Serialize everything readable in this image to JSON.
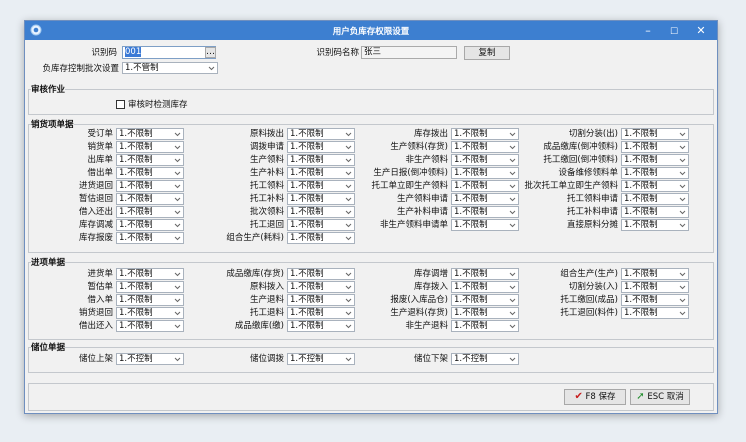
{
  "window": {
    "title": "用户负库存权限设置"
  },
  "header": {
    "code_label": "识别码",
    "code_value": "001",
    "code_name_label": "识别码名称",
    "code_name_value": "张三",
    "copy_label": "复制",
    "batch_label": "负库存控制批次设置",
    "batch_value": "1.不管制"
  },
  "audit": {
    "title": "审核作业",
    "checkbox_label": "审核时检测库存"
  },
  "sales": {
    "title": "销货项单据",
    "fields": [
      {
        "label": "受订单",
        "value": "1.不限制"
      },
      {
        "label": "销货单",
        "value": "1.不限制"
      },
      {
        "label": "出库单",
        "value": "1.不限制"
      },
      {
        "label": "借出单",
        "value": "1.不限制"
      },
      {
        "label": "进货退回",
        "value": "1.不限制"
      },
      {
        "label": "暂估退回",
        "value": "1.不限制"
      },
      {
        "label": "借入还出",
        "value": "1.不限制"
      },
      {
        "label": "库存调减",
        "value": "1.不限制"
      },
      {
        "label": "库存报废",
        "value": "1.不限制"
      },
      {
        "label": "原料拨出",
        "value": "1.不限制"
      },
      {
        "label": "调拨申请",
        "value": "1.不限制"
      },
      {
        "label": "生产领料",
        "value": "1.不限制"
      },
      {
        "label": "生产补料",
        "value": "1.不限制"
      },
      {
        "label": "托工领料",
        "value": "1.不限制"
      },
      {
        "label": "托工补料",
        "value": "1.不限制"
      },
      {
        "label": "批次领料",
        "value": "1.不限制"
      },
      {
        "label": "托工退回",
        "value": "1.不限制"
      },
      {
        "label": "组合生产(耗料)",
        "value": "1.不限制"
      },
      {
        "label": "库存拨出",
        "value": "1.不限制"
      },
      {
        "label": "生产领料(存货)",
        "value": "1.不限制"
      },
      {
        "label": "非生产领料",
        "value": "1.不限制"
      },
      {
        "label": "生产日报(倒冲领料)",
        "value": "1.不限制"
      },
      {
        "label": "托工单立即生产领料",
        "value": "1.不限制"
      },
      {
        "label": "生产领料申请",
        "value": "1.不限制"
      },
      {
        "label": "生产补料申请",
        "value": "1.不限制"
      },
      {
        "label": "非生产领料申请单",
        "value": "1.不限制"
      },
      {
        "label": "切割分装(出)",
        "value": "1.不限制"
      },
      {
        "label": "成品缴库(倒冲领料)",
        "value": "1.不限制"
      },
      {
        "label": "托工缴回(倒冲领料)",
        "value": "1.不限制"
      },
      {
        "label": "设备维修领料单",
        "value": "1.不限制"
      },
      {
        "label": "批次托工单立即生产领料",
        "value": "1.不限制"
      },
      {
        "label": "托工领料申请",
        "value": "1.不限制"
      },
      {
        "label": "托工补料申请",
        "value": "1.不限制"
      },
      {
        "label": "直接原料分摊",
        "value": "1.不限制"
      }
    ]
  },
  "incoming": {
    "title": "进项单据",
    "fields": [
      {
        "label": "进货单",
        "value": "1.不限制"
      },
      {
        "label": "暂估单",
        "value": "1.不限制"
      },
      {
        "label": "借入单",
        "value": "1.不限制"
      },
      {
        "label": "销货退回",
        "value": "1.不限制"
      },
      {
        "label": "借出还入",
        "value": "1.不限制"
      },
      {
        "label": "成品缴库(存货)",
        "value": "1.不限制"
      },
      {
        "label": "原料拨入",
        "value": "1.不限制"
      },
      {
        "label": "生产退料",
        "value": "1.不限制"
      },
      {
        "label": "托工退料",
        "value": "1.不限制"
      },
      {
        "label": "成品缴库(缴)",
        "value": "1.不限制"
      },
      {
        "label": "库存调增",
        "value": "1.不限制"
      },
      {
        "label": "库存拨入",
        "value": "1.不限制"
      },
      {
        "label": "报废(入库品仓)",
        "value": "1.不限制"
      },
      {
        "label": "生产退料(存货)",
        "value": "1.不限制"
      },
      {
        "label": "非生产退料",
        "value": "1.不限制"
      },
      {
        "label": "组合生产(生产)",
        "value": "1.不限制"
      },
      {
        "label": "切割分装(入)",
        "value": "1.不限制"
      },
      {
        "label": "托工缴回(成品)",
        "value": "1.不限制"
      },
      {
        "label": "托工退回(料件)",
        "value": "1.不限制"
      }
    ]
  },
  "location": {
    "title": "储位单据",
    "fields": [
      {
        "label": "储位上架",
        "value": "1.不控制"
      },
      {
        "label": "储位调拨",
        "value": "1.不控制"
      },
      {
        "label": "储位下架",
        "value": "1.不控制"
      }
    ]
  },
  "footer": {
    "save_label": "F8 保存",
    "cancel_label": "ESC 取消"
  },
  "colors": {
    "titlebar": "#3d7fd0",
    "selection": "#3b7ad6"
  }
}
